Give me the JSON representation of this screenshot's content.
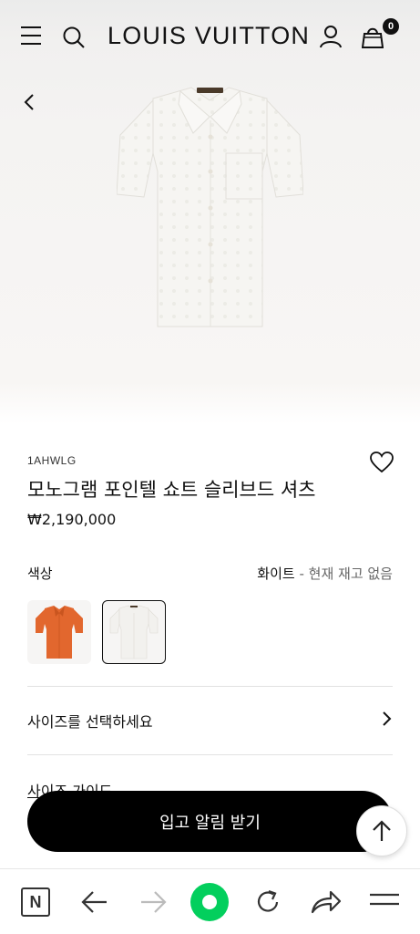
{
  "header": {
    "brand": "LOUIS VUITTON",
    "cart_count": "0"
  },
  "product": {
    "sku": "1AHWLG",
    "name": "모노그램 포인텔 쇼트 슬리브드 셔츠",
    "price": "₩2,190,000",
    "color_label": "색상",
    "color_value": "화이트",
    "availability": "- 현재 재고 없음"
  },
  "size": {
    "select_label": "사이즈를 선택하세요",
    "guide_label": "사이즈 가이드"
  },
  "cta": {
    "notify_label": "입고 알림 받기"
  },
  "colors": {
    "accent_orange": "#e2672e",
    "naver_green": "#03cf5d",
    "button_black": "#000000"
  },
  "browser": {
    "n_label": "N"
  }
}
